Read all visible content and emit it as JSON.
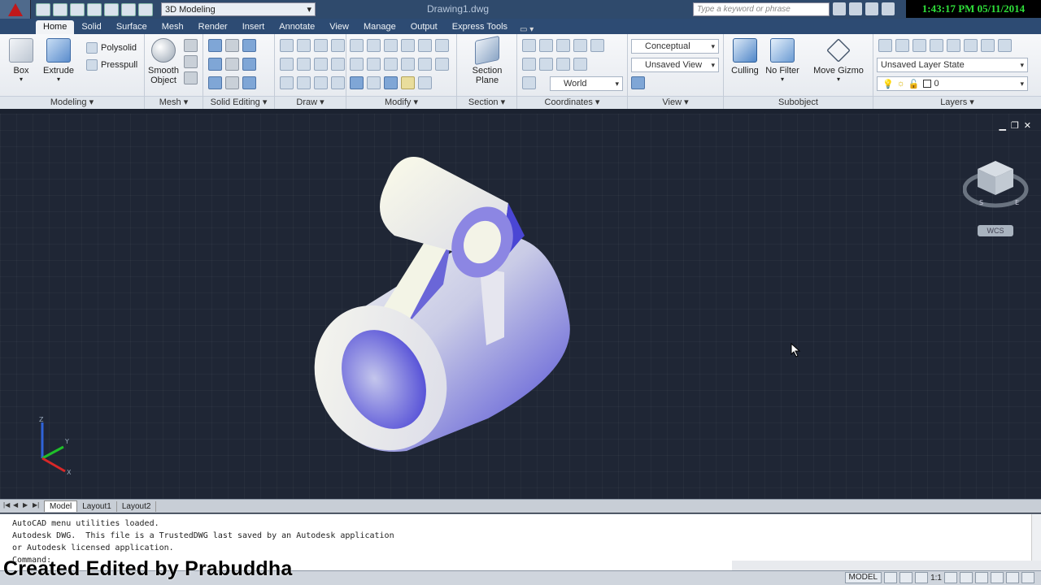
{
  "titlebar": {
    "workspace": "3D Modeling",
    "title": "Drawing1.dwg",
    "search_placeholder": "Type a keyword or phrase",
    "clock": "1:43:17 PM 05/11/2014"
  },
  "tabs": [
    "Home",
    "Solid",
    "Surface",
    "Mesh",
    "Render",
    "Insert",
    "Annotate",
    "View",
    "Manage",
    "Output",
    "Express Tools"
  ],
  "ribbon": {
    "modeling": {
      "title": "Modeling",
      "box": "Box",
      "extrude": "Extrude",
      "polysolid": "Polysolid",
      "presspull": "Presspull"
    },
    "mesh": {
      "title": "Mesh",
      "smooth_line1": "Smooth",
      "smooth_line2": "Object"
    },
    "solid_editing": {
      "title": "Solid Editing"
    },
    "draw": {
      "title": "Draw"
    },
    "modify": {
      "title": "Modify"
    },
    "section": {
      "title": "Section",
      "plane_line1": "Section",
      "plane_line2": "Plane"
    },
    "coordinates": {
      "title": "Coordinates",
      "ucs": "World"
    },
    "view": {
      "title": "View",
      "visual_style": "Conceptual",
      "saved_view": "Unsaved View"
    },
    "subobject": {
      "title": "Subobject",
      "culling": "Culling",
      "no_filter": "No Filter",
      "move_gizmo": "Move Gizmo"
    },
    "layers": {
      "title": "Layers",
      "layer_state": "Unsaved Layer State",
      "current_layer": "0"
    }
  },
  "viewport": {
    "wcs": "WCS",
    "ucs_x": "X",
    "ucs_y": "Y",
    "ucs_z": "Z"
  },
  "layout_tabs": [
    "Model",
    "Layout1",
    "Layout2"
  ],
  "command": {
    "lines": [
      "AutoCAD menu utilities loaded.",
      "Autodesk DWG.  This file is a TrustedDWG last saved by an Autodesk application",
      "or Autodesk licensed application.",
      "Command:"
    ]
  },
  "status": {
    "model": "MODEL",
    "scale": "1:1"
  },
  "watermark": "Created  Edited by Prabuddha"
}
